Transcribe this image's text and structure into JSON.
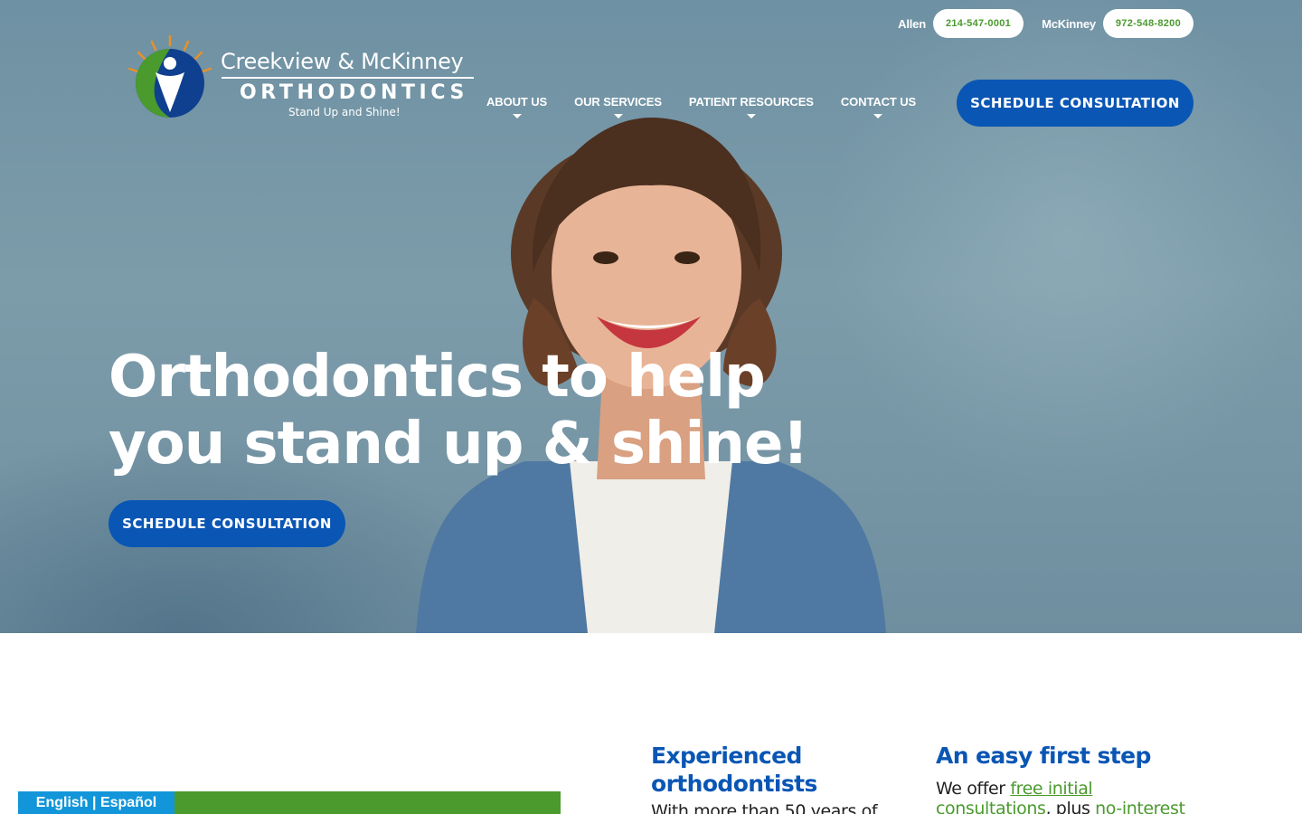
{
  "header": {
    "phones": [
      {
        "location": "Allen",
        "number": "214-547-0001"
      },
      {
        "location": "McKinney",
        "number": "972-548-8200"
      }
    ],
    "logo": {
      "line1": "Creekview & McKinney",
      "line2": "ORTHODONTICS",
      "tagline": "Stand Up and Shine!"
    },
    "nav": [
      {
        "label": "ABOUT US"
      },
      {
        "label": "OUR SERVICES"
      },
      {
        "label": "PATIENT RESOURCES"
      },
      {
        "label": "CONTACT US"
      }
    ],
    "cta_label": "SCHEDULE CONSULTATION"
  },
  "hero": {
    "title_line1": "Orthodontics to help",
    "title_line2": "you stand up & shine!",
    "cta_label": "SCHEDULE CONSULTATION"
  },
  "features": [
    {
      "heading": "Experienced orthodontists",
      "text": "With more than 50 years of"
    },
    {
      "heading": "An easy first step",
      "text_prefix": "We offer ",
      "link1": "free initial",
      "link1_cont": "consultations",
      "text_mid": ", plus ",
      "link2": "no-interest"
    }
  ],
  "language_switch": "English | Español",
  "colors": {
    "brand_blue": "#0a56b4",
    "brand_green": "#4a9a2e",
    "lang_blue": "#1296d9"
  }
}
